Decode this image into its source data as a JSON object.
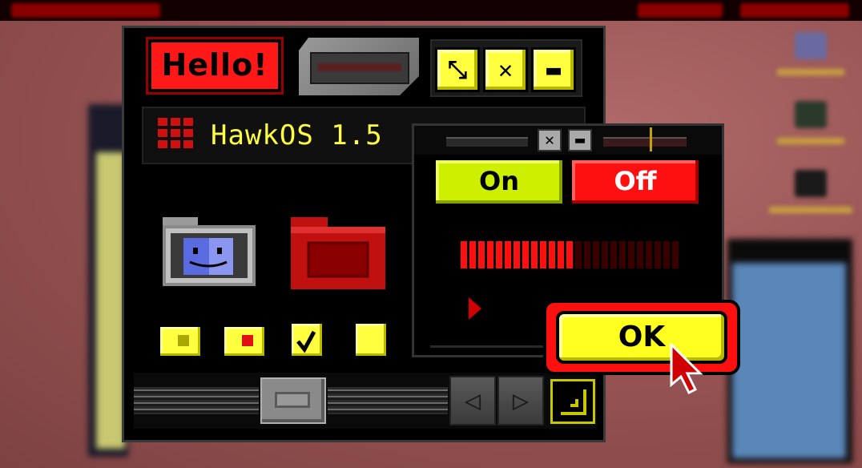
{
  "window": {
    "hello_label": "Hello!",
    "controls": {
      "resize_symbol": "⤡",
      "close_symbol": "✕",
      "minimize_symbol": "▬"
    },
    "os_title": "HawkOS 1.5",
    "scroll_left": "◁",
    "scroll_right": "▷"
  },
  "settings_window": {
    "mini_close": "✕",
    "mini_min": "▬",
    "toggle_on": "On",
    "toggle_off": "Off",
    "progress": {
      "filled_segments": 13,
      "total_segments": 25
    }
  },
  "dialog": {
    "ok_label": "OK"
  },
  "checkboxes": [
    {
      "state": "partial"
    },
    {
      "state": "dot"
    },
    {
      "state": "checked"
    },
    {
      "state": "unchecked"
    }
  ],
  "colors": {
    "accent_yellow": "#ffff40",
    "accent_red": "#ff1010",
    "accent_green": "#ccf000"
  },
  "icons": [
    "grid-logo-icon",
    "finder-folder-icon",
    "red-folder-icon",
    "play-icon",
    "cursor-icon",
    "resize-grip-icon"
  ]
}
